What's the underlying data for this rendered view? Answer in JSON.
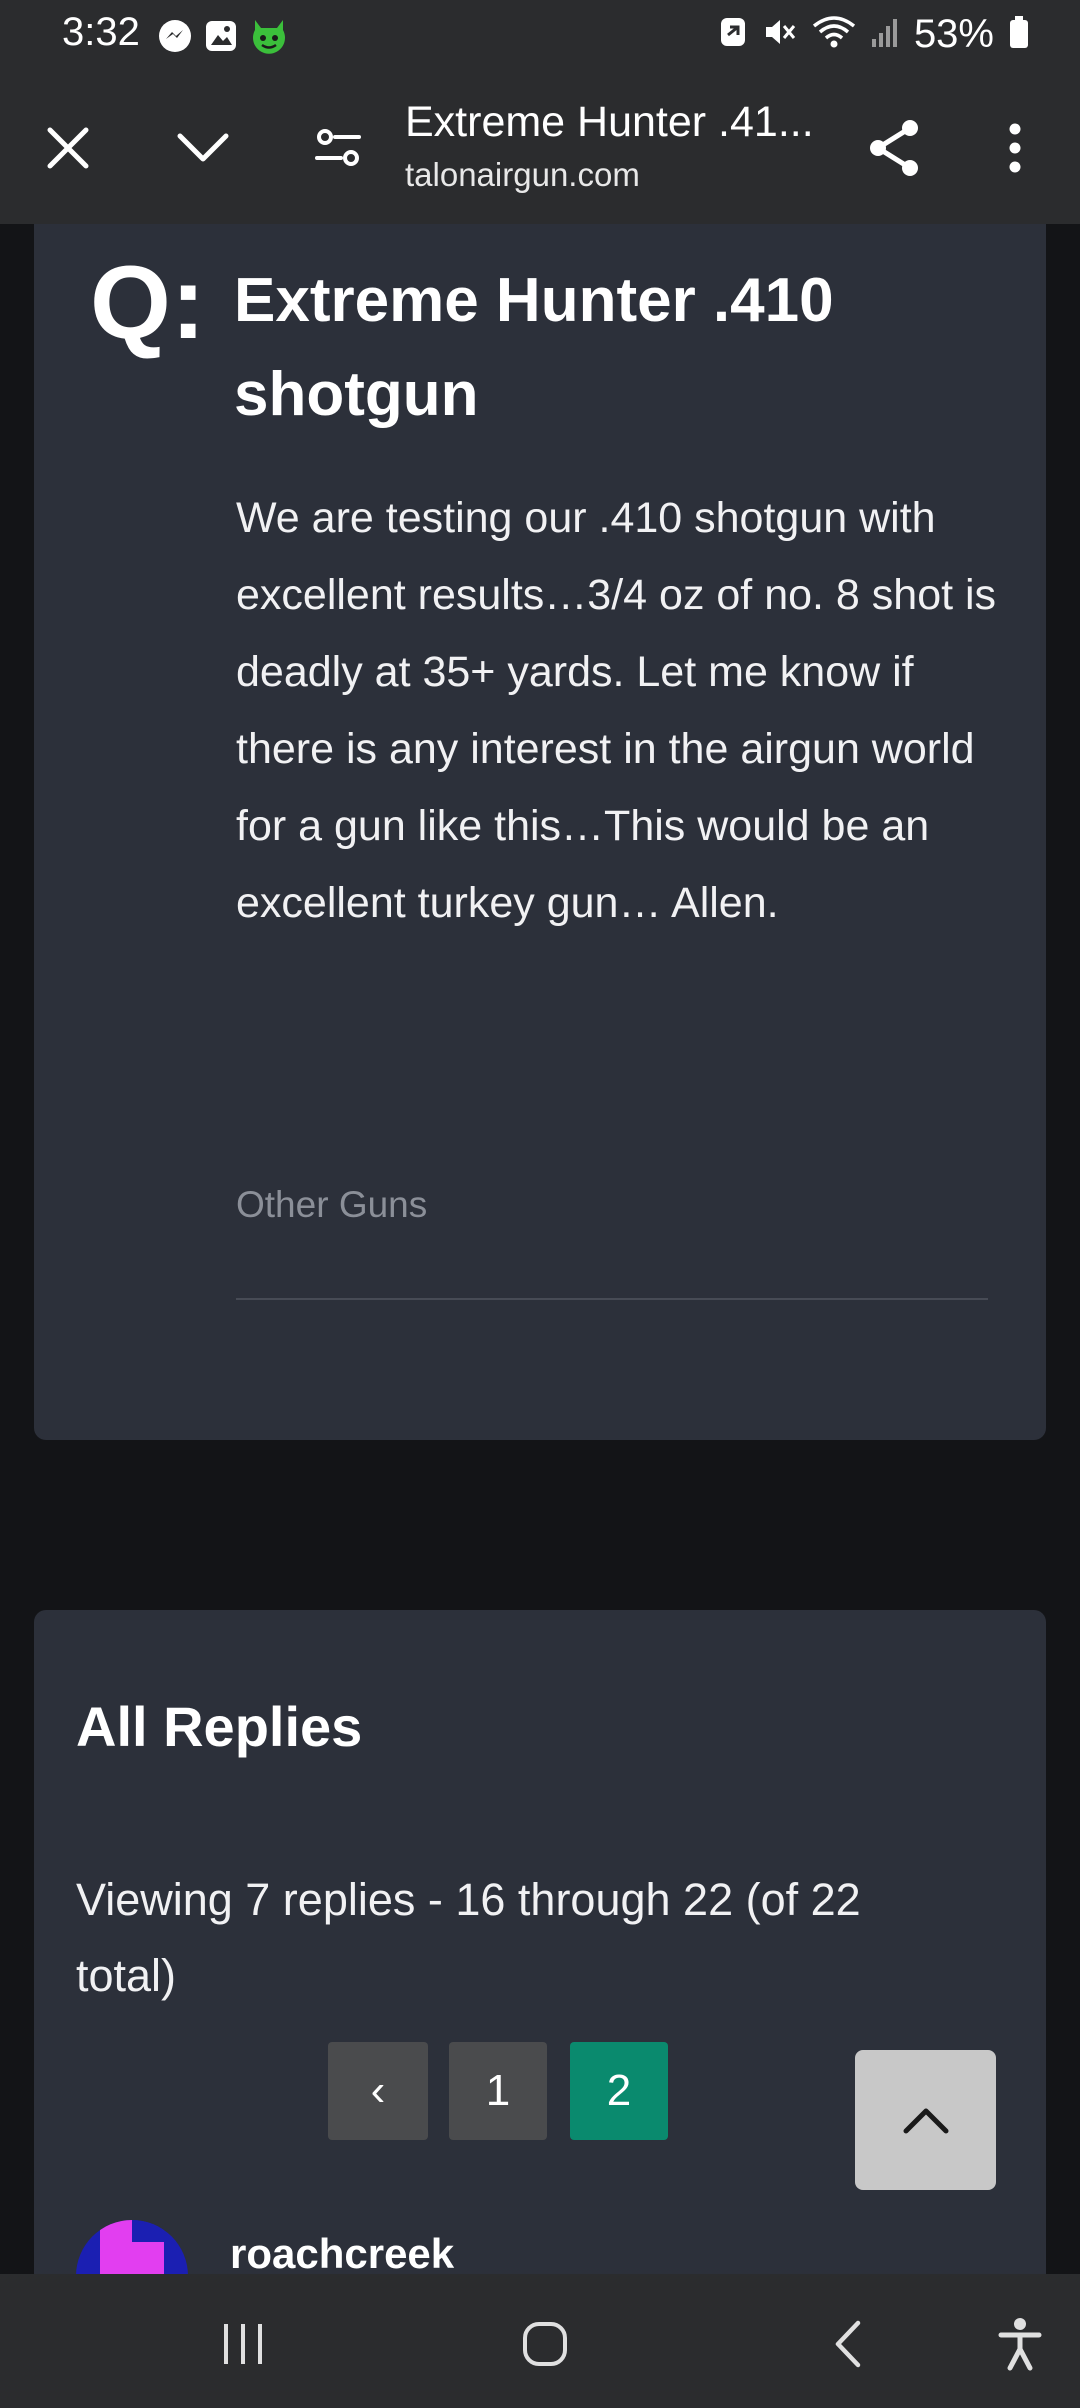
{
  "status_bar": {
    "time": "3:32",
    "battery_percent": "53%",
    "left_icons": [
      "messenger-icon",
      "gallery-icon",
      "app-face-icon"
    ],
    "right_icons": [
      "nfc-icon",
      "mute-icon",
      "wifi-icon",
      "signal-icon",
      "battery-icon"
    ]
  },
  "toolbar": {
    "page_title": "Extreme Hunter .41...",
    "domain": "talonairgun.com",
    "icons": [
      "close-icon",
      "chevron-down-icon",
      "page-settings-icon",
      "share-icon",
      "more-vert-icon"
    ]
  },
  "question": {
    "marker": "Q:",
    "title": "Extreme Hunter .410 shotgun",
    "body": "We are testing our .410 shotgun with excellent results…3/4 oz of no. 8 shot is deadly at 35+ yards. Let me know if there is any interest in the airgun world for a gun like this…This would be an excellent turkey gun… Allen.",
    "category": "Other Guns"
  },
  "replies": {
    "heading": "All Replies",
    "summary": "Viewing 7 replies - 16 through 22 (of 22 total)",
    "pagination": {
      "prev_label": "‹",
      "pages": [
        "1",
        "2"
      ],
      "current_page": "2"
    },
    "first_author": "roachcreek"
  },
  "back_to_top_icon": "chevron-up-icon",
  "nav_bar": {
    "icons": [
      "recents-icon",
      "home-icon",
      "back-icon",
      "accessibility-icon"
    ]
  },
  "colors": {
    "card_bg": "#2c303a",
    "page_bg": "#131417",
    "active_page": "#0a8a6e",
    "muted_text": "#8b8f98"
  }
}
